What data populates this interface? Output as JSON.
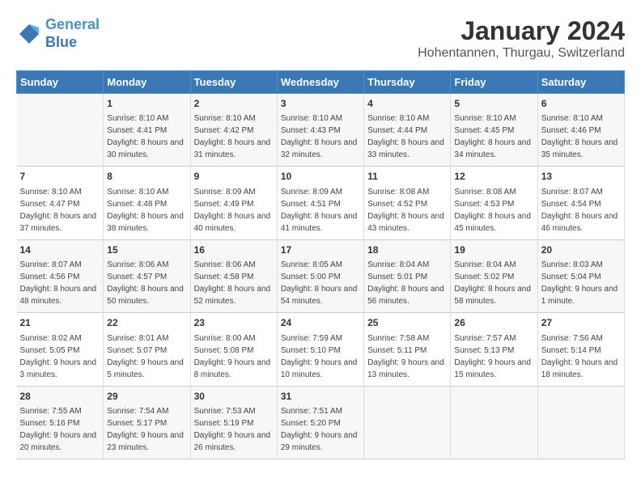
{
  "header": {
    "logo_line1": "General",
    "logo_line2": "Blue",
    "title": "January 2024",
    "subtitle": "Hohentannen, Thurgau, Switzerland"
  },
  "days_of_week": [
    "Sunday",
    "Monday",
    "Tuesday",
    "Wednesday",
    "Thursday",
    "Friday",
    "Saturday"
  ],
  "weeks": [
    [
      {
        "day": "",
        "sunrise": "",
        "sunset": "",
        "daylight": ""
      },
      {
        "day": "1",
        "sunrise": "8:10 AM",
        "sunset": "4:41 PM",
        "daylight": "8 hours and 30 minutes."
      },
      {
        "day": "2",
        "sunrise": "8:10 AM",
        "sunset": "4:42 PM",
        "daylight": "8 hours and 31 minutes."
      },
      {
        "day": "3",
        "sunrise": "8:10 AM",
        "sunset": "4:43 PM",
        "daylight": "8 hours and 32 minutes."
      },
      {
        "day": "4",
        "sunrise": "8:10 AM",
        "sunset": "4:44 PM",
        "daylight": "8 hours and 33 minutes."
      },
      {
        "day": "5",
        "sunrise": "8:10 AM",
        "sunset": "4:45 PM",
        "daylight": "8 hours and 34 minutes."
      },
      {
        "day": "6",
        "sunrise": "8:10 AM",
        "sunset": "4:46 PM",
        "daylight": "8 hours and 35 minutes."
      }
    ],
    [
      {
        "day": "7",
        "sunrise": "8:10 AM",
        "sunset": "4:47 PM",
        "daylight": "8 hours and 37 minutes."
      },
      {
        "day": "8",
        "sunrise": "8:10 AM",
        "sunset": "4:48 PM",
        "daylight": "8 hours and 38 minutes."
      },
      {
        "day": "9",
        "sunrise": "8:09 AM",
        "sunset": "4:49 PM",
        "daylight": "8 hours and 40 minutes."
      },
      {
        "day": "10",
        "sunrise": "8:09 AM",
        "sunset": "4:51 PM",
        "daylight": "8 hours and 41 minutes."
      },
      {
        "day": "11",
        "sunrise": "8:08 AM",
        "sunset": "4:52 PM",
        "daylight": "8 hours and 43 minutes."
      },
      {
        "day": "12",
        "sunrise": "8:08 AM",
        "sunset": "4:53 PM",
        "daylight": "8 hours and 45 minutes."
      },
      {
        "day": "13",
        "sunrise": "8:07 AM",
        "sunset": "4:54 PM",
        "daylight": "8 hours and 46 minutes."
      }
    ],
    [
      {
        "day": "14",
        "sunrise": "8:07 AM",
        "sunset": "4:56 PM",
        "daylight": "8 hours and 48 minutes."
      },
      {
        "day": "15",
        "sunrise": "8:06 AM",
        "sunset": "4:57 PM",
        "daylight": "8 hours and 50 minutes."
      },
      {
        "day": "16",
        "sunrise": "8:06 AM",
        "sunset": "4:58 PM",
        "daylight": "8 hours and 52 minutes."
      },
      {
        "day": "17",
        "sunrise": "8:05 AM",
        "sunset": "5:00 PM",
        "daylight": "8 hours and 54 minutes."
      },
      {
        "day": "18",
        "sunrise": "8:04 AM",
        "sunset": "5:01 PM",
        "daylight": "8 hours and 56 minutes."
      },
      {
        "day": "19",
        "sunrise": "8:04 AM",
        "sunset": "5:02 PM",
        "daylight": "8 hours and 58 minutes."
      },
      {
        "day": "20",
        "sunrise": "8:03 AM",
        "sunset": "5:04 PM",
        "daylight": "9 hours and 1 minute."
      }
    ],
    [
      {
        "day": "21",
        "sunrise": "8:02 AM",
        "sunset": "5:05 PM",
        "daylight": "9 hours and 3 minutes."
      },
      {
        "day": "22",
        "sunrise": "8:01 AM",
        "sunset": "5:07 PM",
        "daylight": "9 hours and 5 minutes."
      },
      {
        "day": "23",
        "sunrise": "8:00 AM",
        "sunset": "5:08 PM",
        "daylight": "9 hours and 8 minutes."
      },
      {
        "day": "24",
        "sunrise": "7:59 AM",
        "sunset": "5:10 PM",
        "daylight": "9 hours and 10 minutes."
      },
      {
        "day": "25",
        "sunrise": "7:58 AM",
        "sunset": "5:11 PM",
        "daylight": "9 hours and 13 minutes."
      },
      {
        "day": "26",
        "sunrise": "7:57 AM",
        "sunset": "5:13 PM",
        "daylight": "9 hours and 15 minutes."
      },
      {
        "day": "27",
        "sunrise": "7:56 AM",
        "sunset": "5:14 PM",
        "daylight": "9 hours and 18 minutes."
      }
    ],
    [
      {
        "day": "28",
        "sunrise": "7:55 AM",
        "sunset": "5:16 PM",
        "daylight": "9 hours and 20 minutes."
      },
      {
        "day": "29",
        "sunrise": "7:54 AM",
        "sunset": "5:17 PM",
        "daylight": "9 hours and 23 minutes."
      },
      {
        "day": "30",
        "sunrise": "7:53 AM",
        "sunset": "5:19 PM",
        "daylight": "9 hours and 26 minutes."
      },
      {
        "day": "31",
        "sunrise": "7:51 AM",
        "sunset": "5:20 PM",
        "daylight": "9 hours and 29 minutes."
      },
      {
        "day": "",
        "sunrise": "",
        "sunset": "",
        "daylight": ""
      },
      {
        "day": "",
        "sunrise": "",
        "sunset": "",
        "daylight": ""
      },
      {
        "day": "",
        "sunrise": "",
        "sunset": "",
        "daylight": ""
      }
    ]
  ]
}
